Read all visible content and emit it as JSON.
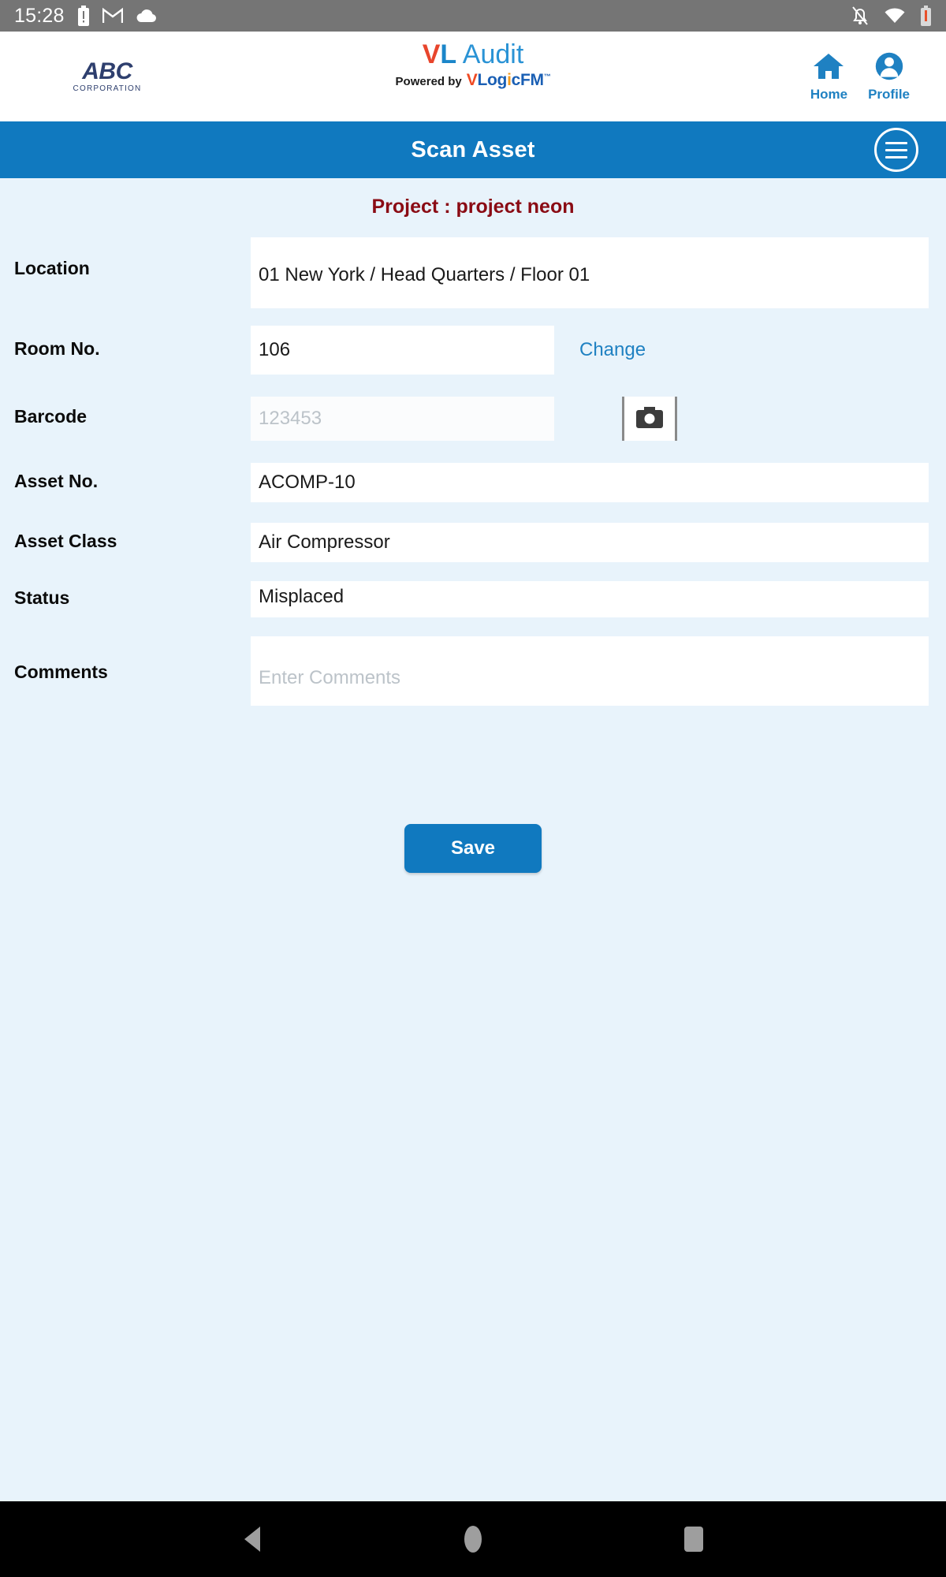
{
  "status_bar": {
    "time": "15:28",
    "left_icons": [
      "battery-alert-icon",
      "gmail-icon",
      "cloud-icon"
    ],
    "right_icons": [
      "notifications-off-icon",
      "wifi-icon",
      "battery-low-icon"
    ]
  },
  "brand_header": {
    "company_logo_main": "ABC",
    "company_logo_sub": "CORPORATION",
    "app_name_v": "V",
    "app_name_l": "L",
    "app_name_rest": " Audit",
    "powered_by": "Powered by",
    "vendor_v": "V",
    "vendor_log": "Log",
    "vendor_i": "i",
    "vendor_c": "c",
    "vendor_fm": "FM",
    "vendor_tm": "™",
    "actions": [
      {
        "label": "Home",
        "icon": "home-icon"
      },
      {
        "label": "Profile",
        "icon": "profile-icon"
      }
    ]
  },
  "title_bar": {
    "title": "Scan Asset",
    "menu_icon": "hamburger-menu-icon"
  },
  "project": {
    "text": "Project : project neon"
  },
  "form": {
    "location": {
      "label": "Location",
      "value": "01 New York / Head Quarters / Floor 01"
    },
    "room_no": {
      "label": "Room No.",
      "value": "106",
      "change_label": "Change"
    },
    "barcode": {
      "label": "Barcode",
      "value": "",
      "placeholder": "123453",
      "camera_icon": "camera-icon"
    },
    "asset_no": {
      "label": "Asset No.",
      "value": "ACOMP-10"
    },
    "asset_class": {
      "label": "Asset Class",
      "value": "Air Compressor"
    },
    "status": {
      "label": "Status",
      "value": "Misplaced"
    },
    "comments": {
      "label": "Comments",
      "value": "",
      "placeholder": "Enter Comments"
    }
  },
  "actions": {
    "save_label": "Save"
  },
  "nav_bar": {
    "back": "back-icon",
    "home": "home-circle-icon",
    "recents": "recents-icon"
  },
  "colors": {
    "accent_blue": "#1079bf",
    "link_blue": "#1f81c2",
    "project_red": "#8a0b14",
    "page_bg": "#e8f3fb",
    "status_bar_bg": "#757575"
  }
}
